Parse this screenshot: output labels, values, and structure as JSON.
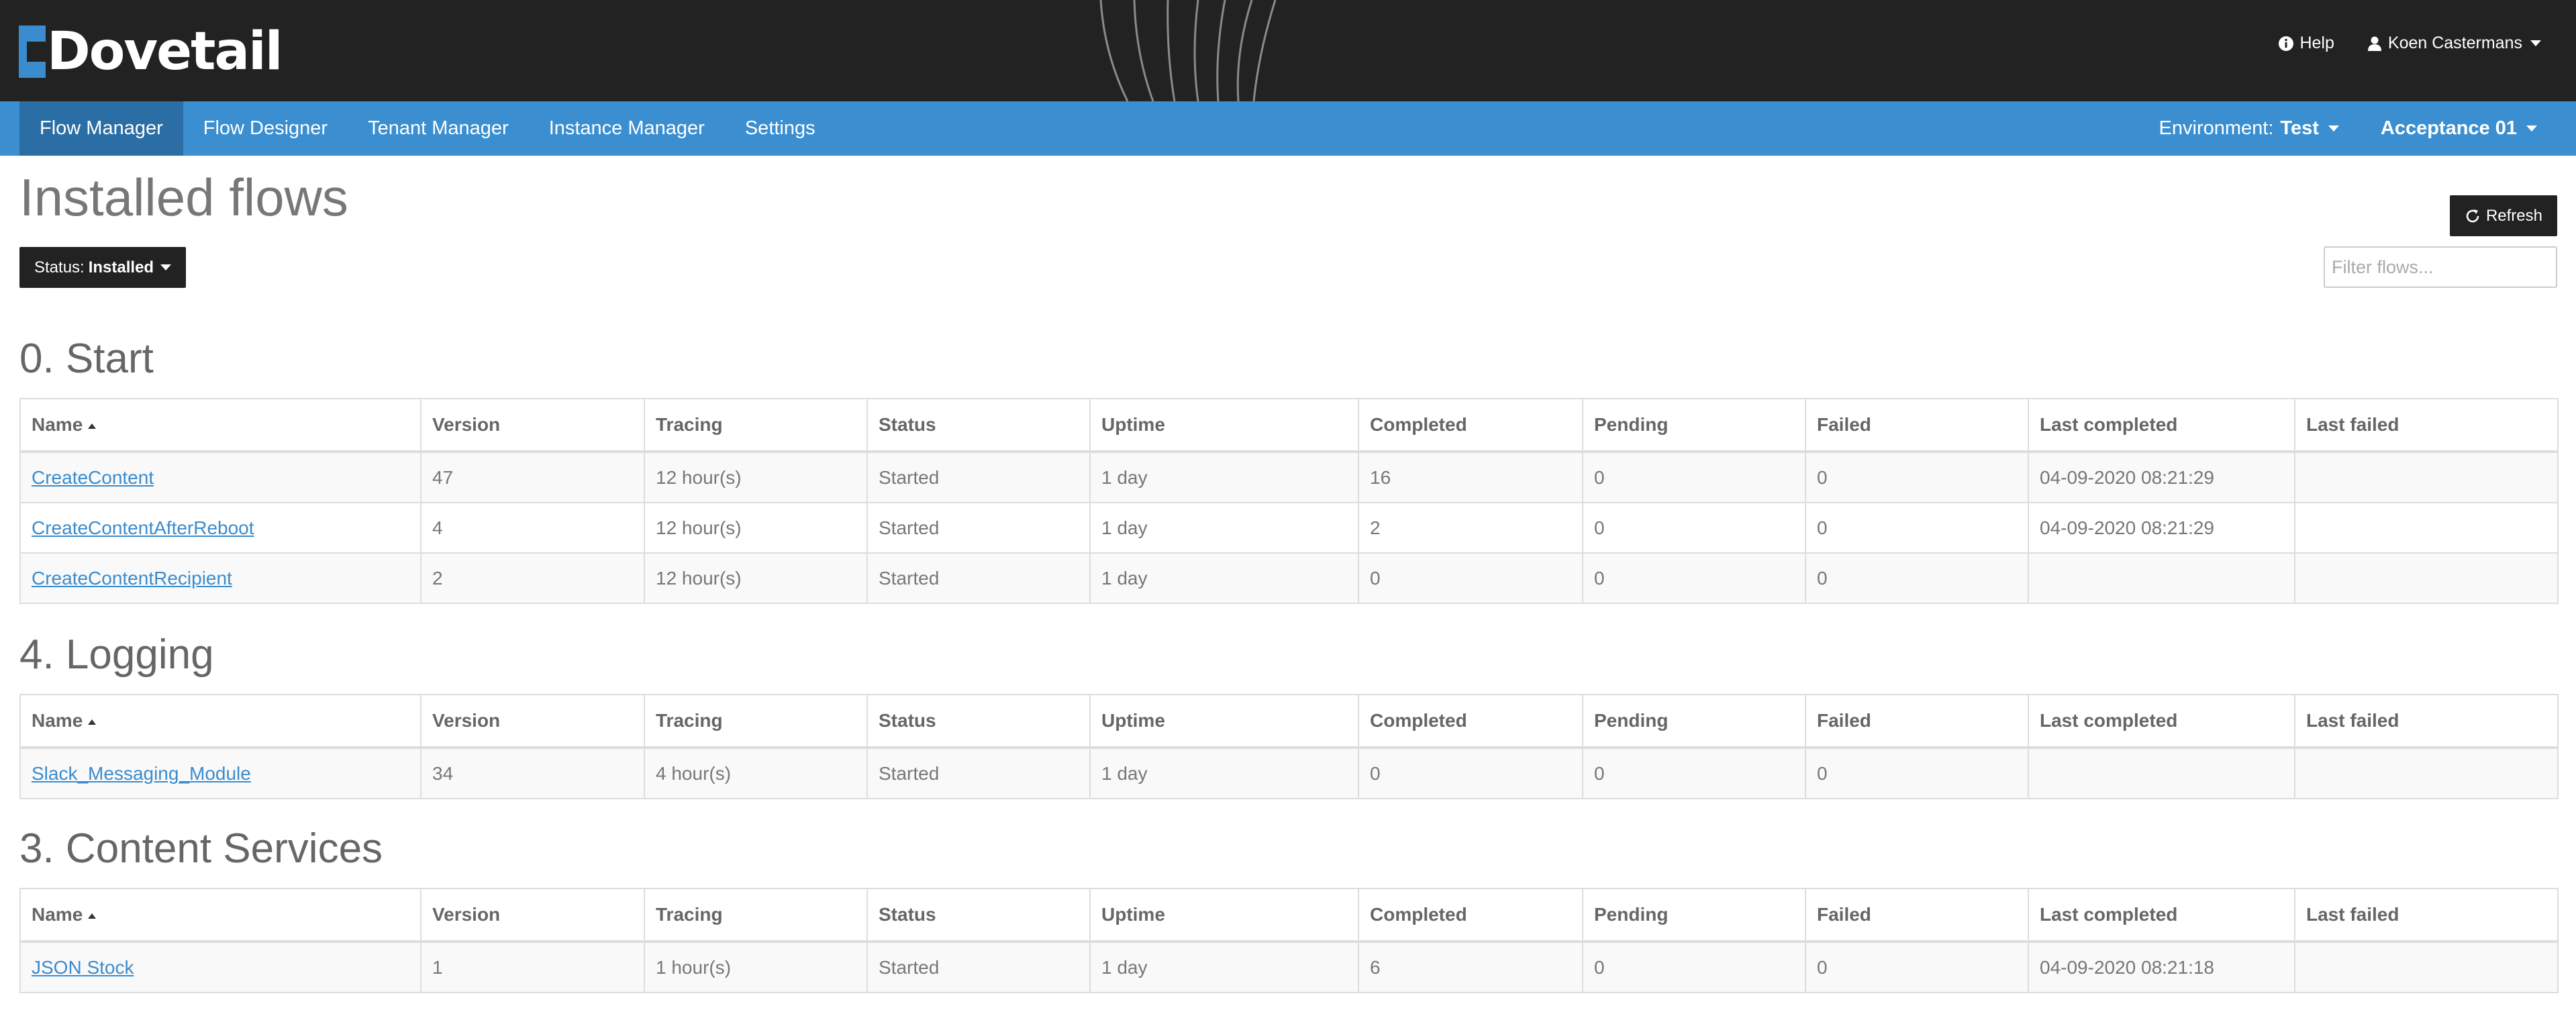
{
  "header": {
    "logo_text": "Dovetail",
    "help_label": "Help",
    "user_label": "Koen Castermans"
  },
  "nav": {
    "items": [
      {
        "label": "Flow Manager",
        "active": true
      },
      {
        "label": "Flow Designer",
        "active": false
      },
      {
        "label": "Tenant Manager",
        "active": false
      },
      {
        "label": "Instance Manager",
        "active": false
      },
      {
        "label": "Settings",
        "active": false
      }
    ],
    "environment_label": "Environment:",
    "environment_value": "Test",
    "instance_value": "Acceptance 01"
  },
  "page": {
    "title": "Installed flows",
    "status_label": "Status:",
    "status_value": "Installed",
    "refresh_label": "Refresh",
    "filter_placeholder": "Filter flows..."
  },
  "columns": [
    "Name",
    "Version",
    "Tracing",
    "Status",
    "Uptime",
    "Completed",
    "Pending",
    "Failed",
    "Last completed",
    "Last failed"
  ],
  "sections": [
    {
      "title": "0. Start",
      "rows": [
        [
          "CreateContent",
          "47",
          "12 hour(s)",
          "Started",
          "1 day",
          "16",
          "0",
          "0",
          "04-09-2020 08:21:29",
          ""
        ],
        [
          "CreateContentAfterReboot",
          "4",
          "12 hour(s)",
          "Started",
          "1 day",
          "2",
          "0",
          "0",
          "04-09-2020 08:21:29",
          ""
        ],
        [
          "CreateContentRecipient",
          "2",
          "12 hour(s)",
          "Started",
          "1 day",
          "0",
          "0",
          "0",
          "",
          ""
        ]
      ]
    },
    {
      "title": "4. Logging",
      "rows": [
        [
          "Slack_Messaging_Module",
          "34",
          "4 hour(s)",
          "Started",
          "1 day",
          "0",
          "0",
          "0",
          "",
          ""
        ]
      ]
    },
    {
      "title": "3. Content Services",
      "rows": [
        [
          "JSON Stock",
          "1",
          "1 hour(s)",
          "Started",
          "1 day",
          "6",
          "0",
          "0",
          "04-09-2020 08:21:18",
          ""
        ]
      ]
    }
  ],
  "colors": {
    "header_bg": "#222222",
    "navbar_bg": "#3b8fd0",
    "navbar_active_bg": "#2b6ea6",
    "link": "#3a8cce",
    "button_bg": "#222222"
  }
}
